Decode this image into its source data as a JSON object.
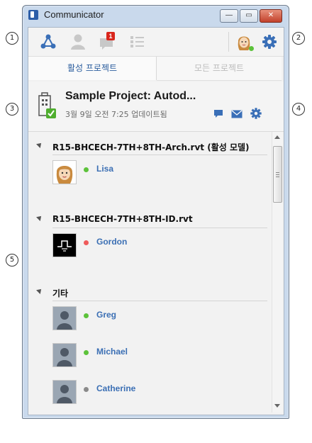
{
  "window": {
    "title": "Communicator"
  },
  "callouts": [
    "1",
    "2",
    "3",
    "4",
    "5"
  ],
  "window_buttons": {
    "minimize": "—",
    "maximize": "▭",
    "close": "✕"
  },
  "toolbar": {
    "notification_count": "1"
  },
  "tabs": [
    {
      "label": "활성 프로젝트",
      "state": "active"
    },
    {
      "label": "모든 프로젝트",
      "state": "inactive"
    }
  ],
  "project": {
    "title": "Sample Project: Autod...",
    "updated": "3월 9일 오전 7:25 업데이트됨"
  },
  "groups": [
    {
      "label": "R15-BHCECH-7TH+8TH-Arch.rvt (활성 모델)",
      "members": [
        {
          "name": "Lisa",
          "status": "online"
        }
      ]
    },
    {
      "label": "R15-BHCECH-7TH+8TH-ID.rvt",
      "members": [
        {
          "name": "Gordon",
          "status": "busy"
        }
      ]
    },
    {
      "label": "기타",
      "members": [
        {
          "name": "Greg",
          "status": "online"
        },
        {
          "name": "Michael",
          "status": "online"
        },
        {
          "name": "Catherine",
          "status": "offline"
        }
      ]
    }
  ],
  "colors": {
    "online": "#5cc23a",
    "busy": "#ef5b5b",
    "offline": "#8a8a8a",
    "accent": "#3b6fb4"
  }
}
